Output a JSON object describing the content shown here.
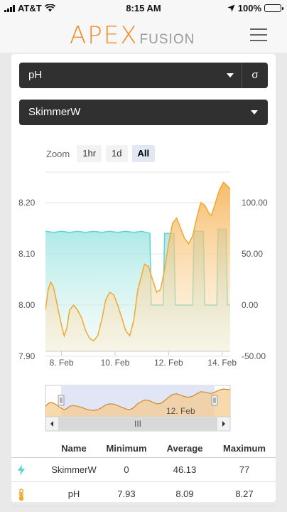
{
  "status_bar": {
    "carrier": "AT&T",
    "time": "8:15 AM",
    "battery": "100%"
  },
  "header": {
    "logo_main": "APEX",
    "logo_sub": "FUSION",
    "menu_icon": "hamburger-icon"
  },
  "controls": {
    "probe_select": "pH",
    "sigma_button": "σ",
    "outlet_select": "SkimmerW",
    "zoom_label": "Zoom",
    "zoom_buttons": [
      "1hr",
      "1d",
      "All"
    ],
    "zoom_active": "All"
  },
  "colors": {
    "brand": "#f28b2c",
    "skimmer_series": "#5fd3d3",
    "ph_series": "#f0a830"
  },
  "chart_data": {
    "type": "area",
    "x_tick_labels": [
      "8. Feb",
      "10. Feb",
      "12. Feb",
      "14. Feb"
    ],
    "y_left_ticks": [
      "8.20",
      "8.10",
      "8.00",
      "7.90"
    ],
    "y_right_ticks": [
      "100.00",
      "50.00",
      "0.00",
      "-50.00"
    ],
    "y_left_range": [
      7.9,
      8.25
    ],
    "y_right_range": [
      -50,
      125
    ],
    "x_range": [
      7.4,
      14.3
    ],
    "series": [
      {
        "name": "SkimmerW",
        "axis": "right",
        "color": "#5fd3d3",
        "points": [
          [
            7.4,
            72
          ],
          [
            7.7,
            71
          ],
          [
            8.0,
            72
          ],
          [
            8.3,
            71
          ],
          [
            8.6,
            72
          ],
          [
            8.9,
            71
          ],
          [
            9.2,
            72
          ],
          [
            9.5,
            71
          ],
          [
            9.8,
            72
          ],
          [
            10.1,
            71
          ],
          [
            10.4,
            72
          ],
          [
            10.7,
            71
          ],
          [
            11.0,
            72
          ],
          [
            11.3,
            70
          ],
          [
            11.35,
            0
          ],
          [
            11.8,
            0
          ],
          [
            11.85,
            70
          ],
          [
            12.2,
            70
          ],
          [
            12.25,
            0
          ],
          [
            12.9,
            0
          ],
          [
            12.95,
            72
          ],
          [
            13.3,
            72
          ],
          [
            13.35,
            0
          ],
          [
            13.8,
            0
          ],
          [
            13.85,
            74
          ],
          [
            14.15,
            74
          ],
          [
            14.2,
            0
          ],
          [
            14.3,
            0
          ]
        ]
      },
      {
        "name": "pH",
        "axis": "left",
        "color": "#f0a830",
        "points": [
          [
            7.4,
            7.99
          ],
          [
            7.5,
            8.03
          ],
          [
            7.6,
            8.045
          ],
          [
            7.7,
            8.035
          ],
          [
            7.8,
            8.01
          ],
          [
            7.9,
            7.985
          ],
          [
            8.0,
            7.96
          ],
          [
            8.1,
            7.94
          ],
          [
            8.2,
            7.955
          ],
          [
            8.3,
            7.99
          ],
          [
            8.45,
            8.0
          ],
          [
            8.6,
            7.99
          ],
          [
            8.75,
            7.975
          ],
          [
            8.9,
            7.95
          ],
          [
            9.05,
            7.935
          ],
          [
            9.2,
            7.93
          ],
          [
            9.35,
            7.94
          ],
          [
            9.5,
            7.97
          ],
          [
            9.65,
            8.01
          ],
          [
            9.8,
            8.025
          ],
          [
            9.95,
            8.02
          ],
          [
            10.1,
            8.0
          ],
          [
            10.25,
            7.975
          ],
          [
            10.4,
            7.95
          ],
          [
            10.55,
            7.94
          ],
          [
            10.7,
            7.97
          ],
          [
            10.85,
            8.03
          ],
          [
            10.95,
            8.05
          ],
          [
            11.1,
            8.08
          ],
          [
            11.25,
            8.075
          ],
          [
            11.4,
            8.05
          ],
          [
            11.55,
            8.025
          ],
          [
            11.7,
            8.03
          ],
          [
            11.85,
            8.07
          ],
          [
            12.0,
            8.12
          ],
          [
            12.15,
            8.16
          ],
          [
            12.3,
            8.17
          ],
          [
            12.45,
            8.15
          ],
          [
            12.6,
            8.13
          ],
          [
            12.75,
            8.12
          ],
          [
            12.9,
            8.135
          ],
          [
            13.05,
            8.17
          ],
          [
            13.2,
            8.2
          ],
          [
            13.35,
            8.195
          ],
          [
            13.5,
            8.18
          ],
          [
            13.6,
            8.175
          ],
          [
            13.75,
            8.2
          ],
          [
            13.9,
            8.225
          ],
          [
            14.05,
            8.24
          ],
          [
            14.15,
            8.235
          ],
          [
            14.25,
            8.23
          ],
          [
            14.3,
            8.225
          ]
        ]
      }
    ],
    "navigator_label": "12. Feb",
    "navigator_scroll_label": "III"
  },
  "stats_table": {
    "columns": [
      "Name",
      "Minimum",
      "Average",
      "Maximum"
    ],
    "rows": [
      {
        "icon": "lightning-icon",
        "name": "SkimmerW",
        "min": "0",
        "avg": "46.13",
        "max": "77"
      },
      {
        "icon": "thermometer-icon",
        "name": "pH",
        "min": "7.93",
        "avg": "8.09",
        "max": "8.27"
      }
    ]
  }
}
